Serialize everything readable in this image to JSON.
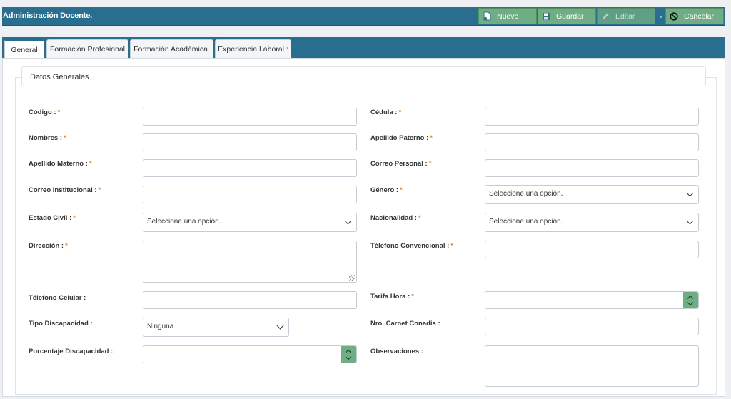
{
  "app": {
    "title": "Administración Docente."
  },
  "toolbar": {
    "nuevo": "Nuevo",
    "guardar": "Guardar",
    "editar": "Editar",
    "cancelar": "Cancelar"
  },
  "tabs": [
    "General",
    "Formación Profesional",
    "Formación Académica.",
    "Experiencia Laboral :"
  ],
  "section": {
    "title": "Datos Generales"
  },
  "form": {
    "codigo": "Código :",
    "cedula": "Cédula :",
    "nombres": "Nombres :",
    "apellido_paterno": "Apellido Paterno :",
    "apellido_materno": "Apellido Materno :",
    "correo_personal": "Correo Personal :",
    "correo_institucional": "Correo Institucional :",
    "genero": "Género :",
    "genero_value": "Seleccione una opción.",
    "estado_civil": "Estado Civil :",
    "estado_civil_value": "Seleccione una opción.",
    "nacionalidad": "Nacionalidad :",
    "nacionalidad_value": "Seleccione una opción.",
    "direccion": "Dirección :",
    "telefono_convencional": "Télefono Convencional :",
    "telefono_celular": "Télefono Celular :",
    "tarifa_hora": "Tarifa Hora :",
    "tipo_discapacidad": "Tipo Discapacidad :",
    "tipo_discapacidad_value": "Ninguna",
    "nro_carnet": "Nro. Carnet Conadis :",
    "porcentaje_discapacidad": "Porcentaje Discapacidad :",
    "observaciones": "Observaciones :",
    "required_mark": "*"
  },
  "colors": {
    "header": "#2a6e8f",
    "button": "#6fae84",
    "required": "#e58a2c"
  },
  "icons": {
    "nuevo": "new-doc-icon",
    "guardar": "save-icon",
    "editar": "edit-icon",
    "cancelar": "cancel-icon"
  }
}
